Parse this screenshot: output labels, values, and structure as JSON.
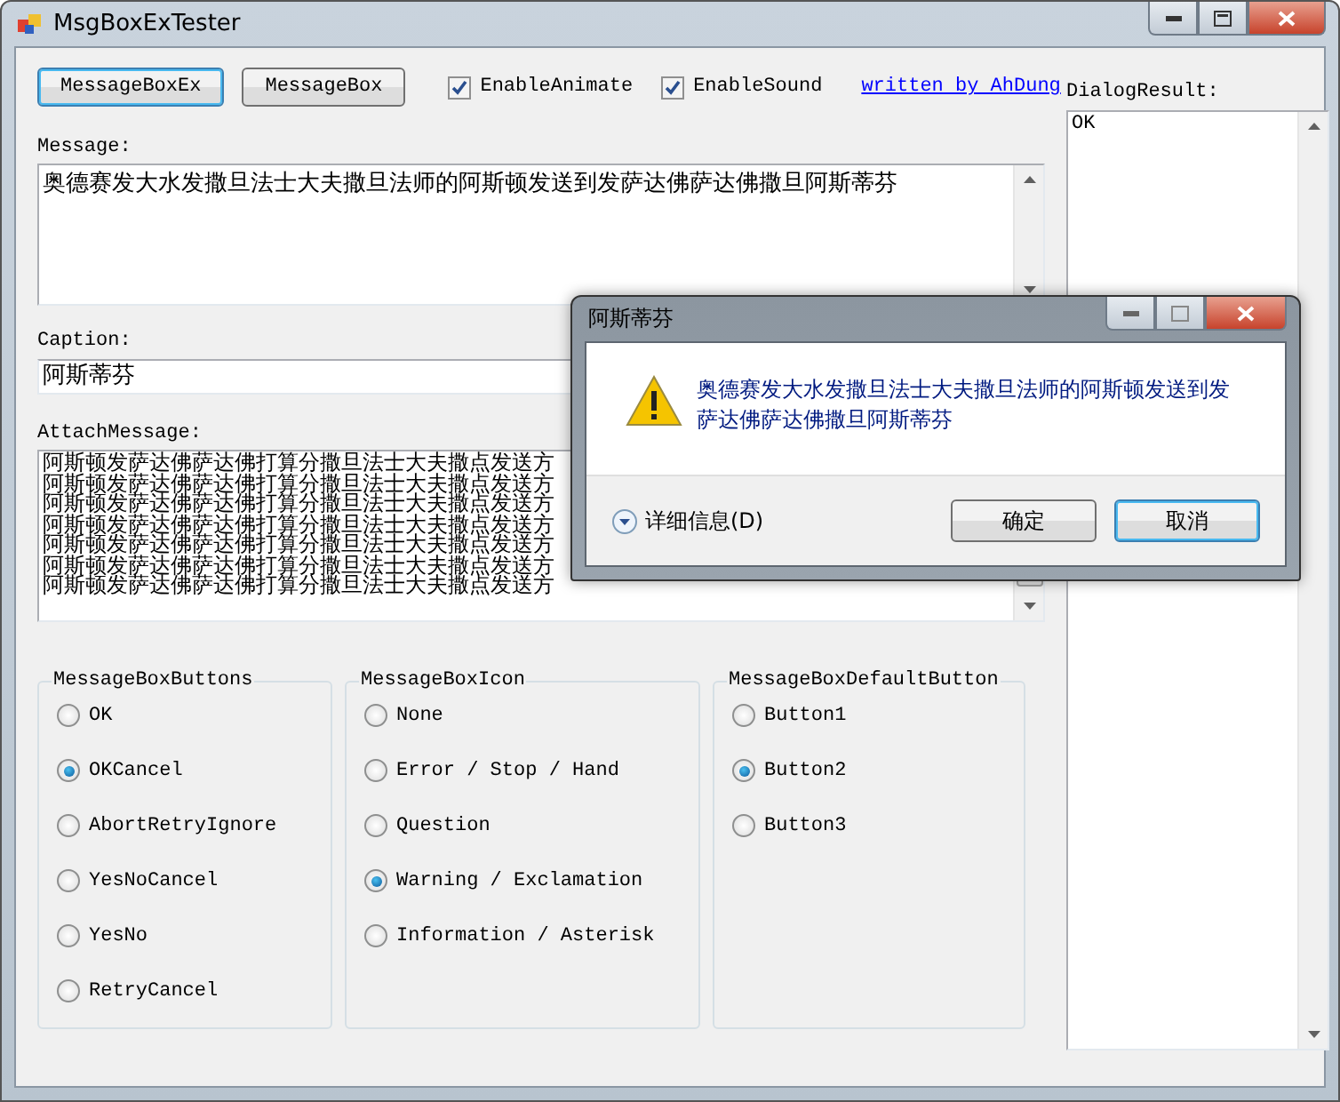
{
  "window": {
    "title": "MsgBoxExTester"
  },
  "toolbar": {
    "buttons": [
      {
        "label": "MessageBoxEx",
        "default": true
      },
      {
        "label": "MessageBox",
        "default": false
      }
    ],
    "checkboxes": [
      {
        "label": "EnableAnimate",
        "checked": true
      },
      {
        "label": "EnableSound",
        "checked": true
      }
    ],
    "link": "written by AhDung"
  },
  "message": {
    "label": "Message:",
    "value": "奥德赛发大水发撒旦法士大夫撒旦法师的阿斯顿发送到发萨达佛萨达佛撒旦阿斯蒂芬"
  },
  "caption": {
    "label": "Caption:",
    "value": "阿斯蒂芬"
  },
  "attach_message": {
    "label": "AttachMessage:",
    "lines": [
      "阿斯顿发萨达佛萨达佛打算分撒旦法士大夫撒点发送方",
      "阿斯顿发萨达佛萨达佛打算分撒旦法士大夫撒点发送方",
      "阿斯顿发萨达佛萨达佛打算分撒旦法士大夫撒点发送方",
      "阿斯顿发萨达佛萨达佛打算分撒旦法士大夫撒点发送方",
      "阿斯顿发萨达佛萨达佛打算分撒旦法士大夫撒点发送方",
      "阿斯顿发萨达佛萨达佛打算分撒旦法士大夫撒点发送方",
      "阿斯顿发萨达佛萨达佛打算分撒旦法士大夫撒点发送方"
    ]
  },
  "groups": [
    {
      "title": "MessageBoxButtons",
      "options": [
        {
          "label": "OK",
          "selected": false
        },
        {
          "label": "OKCancel",
          "selected": true
        },
        {
          "label": "AbortRetryIgnore",
          "selected": false
        },
        {
          "label": "YesNoCancel",
          "selected": false
        },
        {
          "label": "YesNo",
          "selected": false
        },
        {
          "label": "RetryCancel",
          "selected": false
        }
      ]
    },
    {
      "title": "MessageBoxIcon",
      "options": [
        {
          "label": "None",
          "selected": false
        },
        {
          "label": "Error / Stop / Hand",
          "selected": false
        },
        {
          "label": "Question",
          "selected": false
        },
        {
          "label": "Warning / Exclamation",
          "selected": true
        },
        {
          "label": "Information / Asterisk",
          "selected": false
        }
      ]
    },
    {
      "title": "MessageBoxDefaultButton",
      "options": [
        {
          "label": "Button1",
          "selected": false
        },
        {
          "label": "Button2",
          "selected": true
        },
        {
          "label": "Button3",
          "selected": false
        }
      ]
    }
  ],
  "dialog_result": {
    "label": "DialogResult:",
    "value": "OK"
  },
  "dialog": {
    "title": "阿斯蒂芬",
    "message": "奥德赛发大水发撒旦法士大夫撒旦法师的阿斯顿发送到发萨达佛萨达佛撒旦阿斯蒂芬",
    "details": "详细信息(D)",
    "buttons": [
      {
        "label": "确定",
        "default": false
      },
      {
        "label": "取消",
        "default": true
      }
    ]
  }
}
